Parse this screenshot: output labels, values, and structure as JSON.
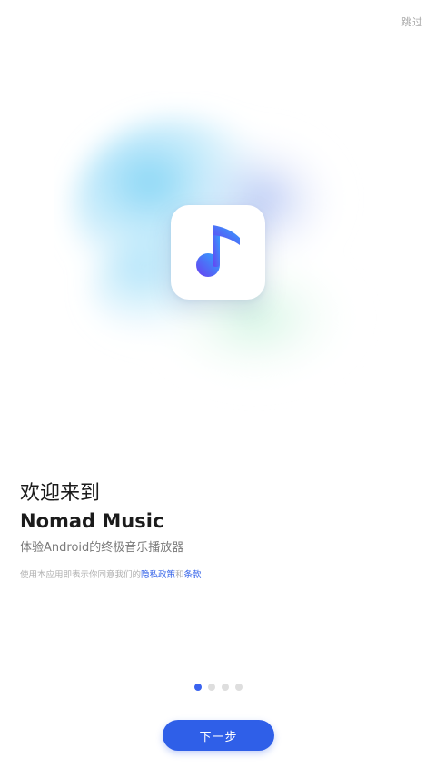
{
  "header": {
    "skip_label": "跳过"
  },
  "hero": {
    "icon": "music-note-icon",
    "colors": {
      "note_gradient_start": "#6a3df0",
      "note_gradient_end": "#2ea8ff",
      "blob_blue": "#8fd6f7",
      "blob_green": "#d6f5e6"
    }
  },
  "intro": {
    "welcome": "欢迎来到",
    "app_name": "Nomad Music",
    "tagline": "体验Android的终极音乐播放器",
    "legal_prefix": "使用本应用即表示你同意我们的",
    "privacy_link": "隐私政策",
    "legal_conjunction": "和",
    "terms_link": "条款"
  },
  "pager": {
    "total": 4,
    "current": 1
  },
  "footer": {
    "next_label": "下一步"
  },
  "theme": {
    "accent": "#2f5fe8"
  }
}
